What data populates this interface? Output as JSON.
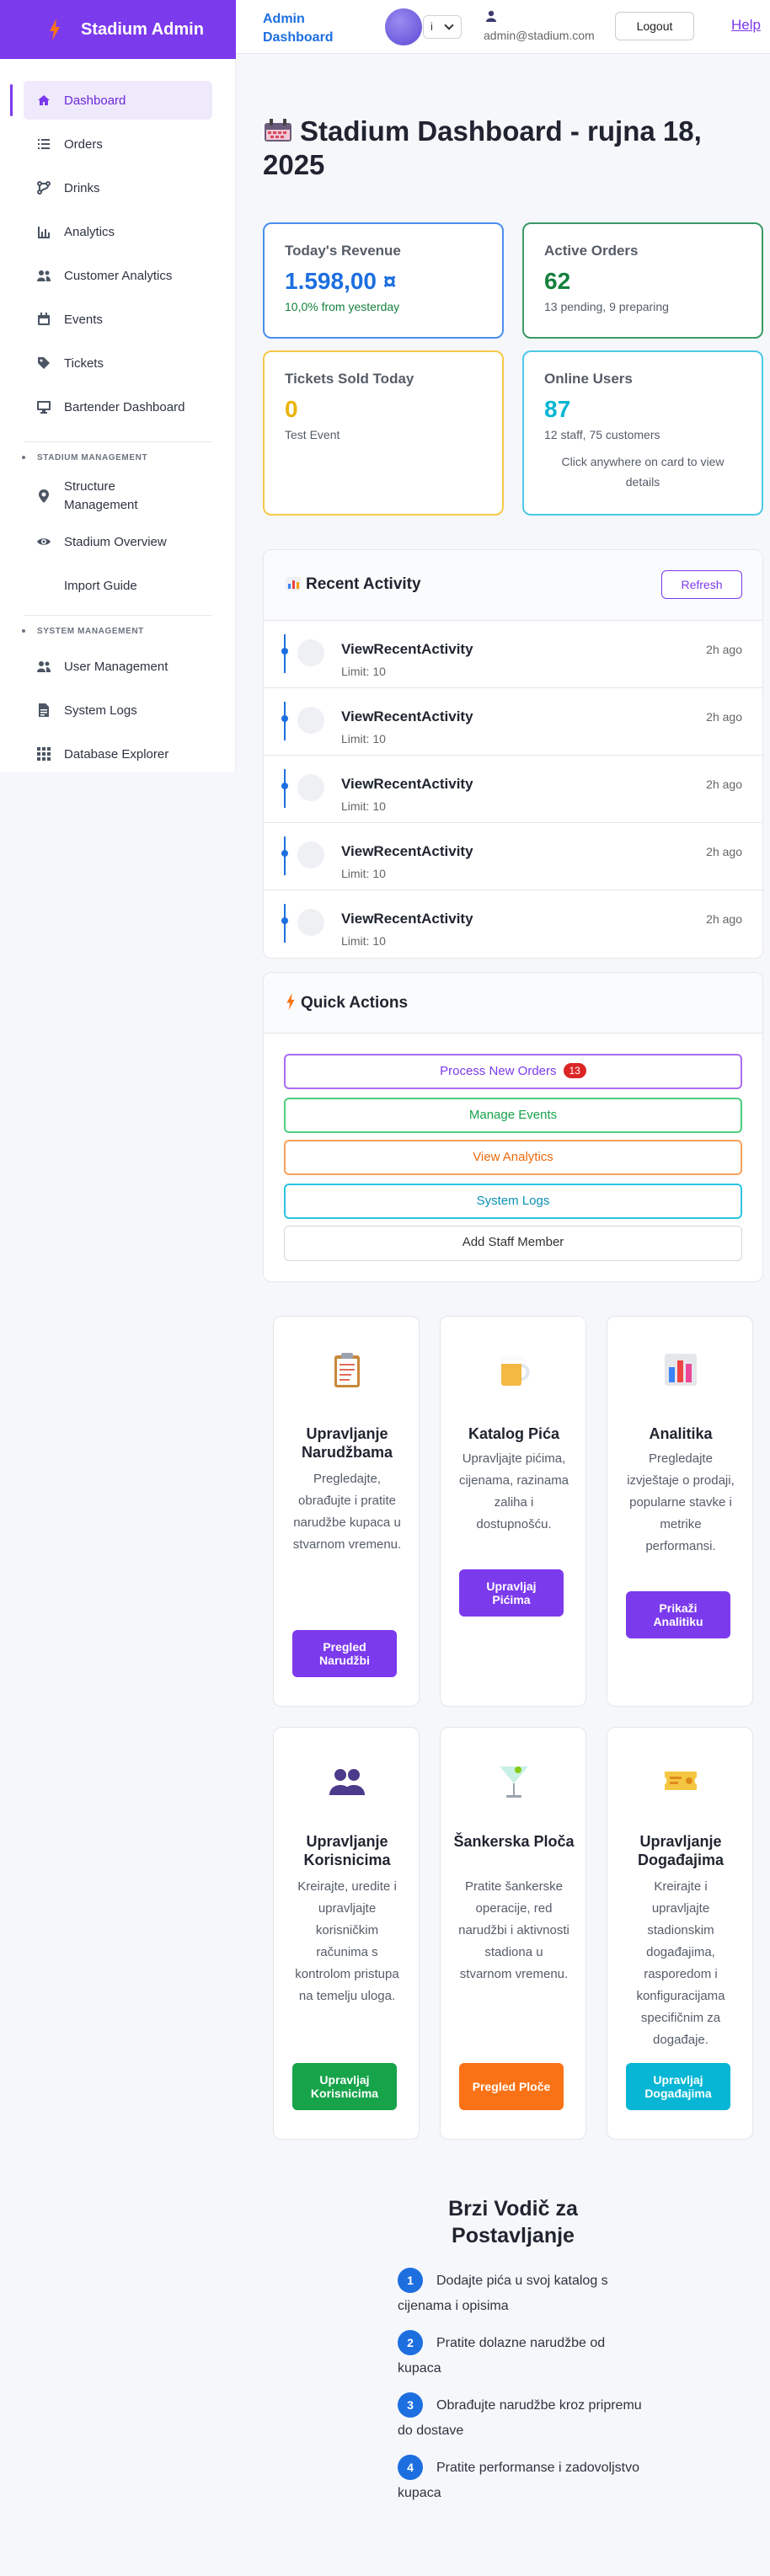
{
  "brand": {
    "name": "Stadium Admin"
  },
  "header": {
    "title": "Admin Dashboard",
    "lang_value": "i",
    "user_email": "admin@stadium.com",
    "logout": "Logout",
    "help": "Help"
  },
  "sidebar": {
    "items": [
      {
        "label": "Dashboard",
        "icon": "home-icon",
        "active": true
      },
      {
        "label": "Orders",
        "icon": "list-icon"
      },
      {
        "label": "Drinks",
        "icon": "flow-icon"
      },
      {
        "label": "Analytics",
        "icon": "bar-chart-icon"
      },
      {
        "label": "Customer Analytics",
        "icon": "users-icon"
      },
      {
        "label": "Events",
        "icon": "calendar-icon"
      },
      {
        "label": "Tickets",
        "icon": "tag-icon"
      },
      {
        "label": "Bartender Dashboard",
        "icon": "monitor-icon"
      }
    ],
    "section1": "STADIUM MANAGEMENT",
    "section1_items": [
      {
        "label": "Structure Management",
        "icon": "pin-icon"
      },
      {
        "label": "Stadium Overview",
        "icon": "eye-icon"
      },
      {
        "label": "Import Guide",
        "icon": ""
      }
    ],
    "section2": "SYSTEM MANAGEMENT",
    "section2_items": [
      {
        "label": "User Management",
        "icon": "users-icon"
      },
      {
        "label": "System Logs",
        "icon": "document-icon"
      },
      {
        "label": "Database Explorer",
        "icon": "grid-icon"
      }
    ]
  },
  "page": {
    "title": "Stadium Dashboard - rujna 18, 2025"
  },
  "stats": {
    "revenue": {
      "label": "Today's Revenue",
      "value": "1.598,00 ¤",
      "sub": "10,0% from yesterday",
      "color": "#1d6fe0"
    },
    "orders": {
      "label": "Active Orders",
      "value": "62",
      "sub": "13 pending, 9 preparing",
      "color": "#15803d"
    },
    "tickets": {
      "label": "Tickets Sold Today",
      "value": "0",
      "sub": "Test Event",
      "color": "#eab308"
    },
    "online": {
      "label": "Online Users",
      "value": "87",
      "sub": "12 staff, 75 customers",
      "hint": "Click anywhere on card to view details",
      "color": "#06b6d4"
    }
  },
  "activity": {
    "title": "Recent Activity",
    "refresh": "Refresh",
    "rows": [
      {
        "name": "ViewRecentActivity",
        "meta": "Limit: 10",
        "time": "2h ago"
      },
      {
        "name": "ViewRecentActivity",
        "meta": "Limit: 10",
        "time": "2h ago"
      },
      {
        "name": "ViewRecentActivity",
        "meta": "Limit: 10",
        "time": "2h ago"
      },
      {
        "name": "ViewRecentActivity",
        "meta": "Limit: 10",
        "time": "2h ago"
      },
      {
        "name": "ViewRecentActivity",
        "meta": "Limit: 10",
        "time": "2h ago"
      }
    ]
  },
  "quick": {
    "title": "Quick Actions",
    "process": "Process New Orders",
    "process_badge": "13",
    "events": "Manage Events",
    "analytics": "View Analytics",
    "logs": "System Logs",
    "staff": "Add Staff Member"
  },
  "features": [
    {
      "title": "Upravljanje Narudžbama",
      "desc": "Pregledajte, obrađujte i pratite narudžbe kupaca u stvarnom vremenu.",
      "button": "Pregled Narudžbi",
      "icon": "clipboard-icon",
      "color": "#7c3aed"
    },
    {
      "title": "Katalog Pića",
      "desc": "Upravljajte pićima, cijenama, razinama zaliha i dostupnošću.",
      "button": "Upravljaj Pićima",
      "icon": "beer-icon",
      "color": "#7c3aed"
    },
    {
      "title": "Analitika",
      "desc": "Pregledajte izvještaje o prodaji, popularne stavke i metrike performansi.",
      "button": "Prikaži Analitiku",
      "icon": "chart-icon",
      "color": "#7c3aed"
    },
    {
      "title": "Upravljanje Korisnicima",
      "desc": "Kreirajte, uredite i upravljajte korisničkim računima s kontrolom pristupa na temelju uloga.",
      "button": "Upravljaj Korisnicima",
      "icon": "people-icon",
      "color": "#16a34a"
    },
    {
      "title": "Šankerska Ploča",
      "desc": "Pratite šankerske operacije, red narudžbi i aktivnosti stadiona u stvarnom vremenu.",
      "button": "Pregled Ploče",
      "icon": "cocktail-icon",
      "color": "#f97316"
    },
    {
      "title": "Upravljanje Događajima",
      "desc": "Kreirajte i upravljajte stadionskim događajima, rasporedom i konfiguracijama specifičnim za događaje.",
      "button": "Upravljaj Događajima",
      "icon": "ticket-icon",
      "color": "#06b6d4"
    }
  ],
  "guide": {
    "title": "Brzi Vodič za Postavljanje",
    "steps": [
      {
        "num": "1",
        "text": "Dodajte pića u svoj katalog s cijenama i opisima"
      },
      {
        "num": "2",
        "text": "Pratite dolazne narudžbe od kupaca"
      },
      {
        "num": "3",
        "text": "Obrađujte narudžbe kroz pripremu do dostave"
      },
      {
        "num": "4",
        "text": "Pratite performanse i zadovoljstvo kupaca"
      }
    ]
  }
}
